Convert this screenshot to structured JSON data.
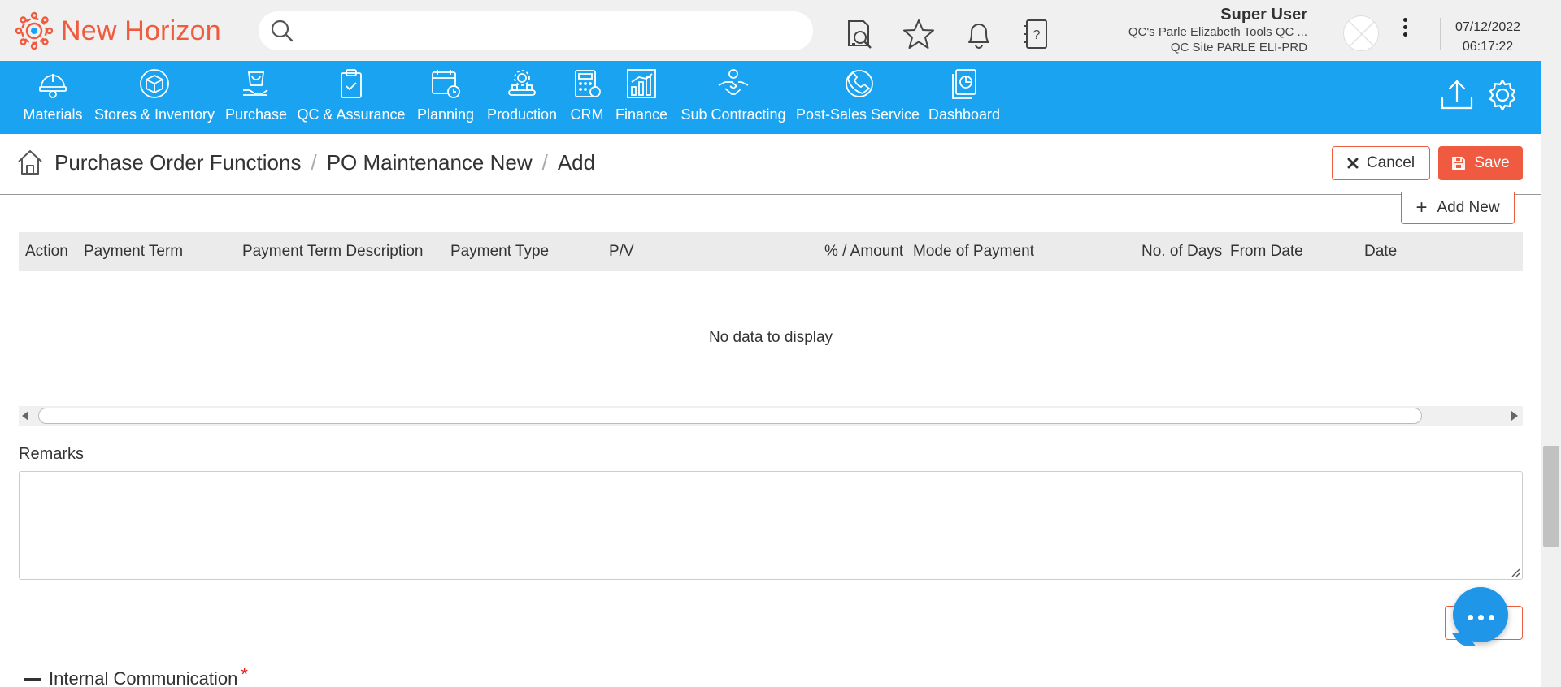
{
  "app": {
    "title": "New Horizon"
  },
  "search": {
    "placeholder": "",
    "value": ""
  },
  "user": {
    "name": "Super User",
    "company": "QC's Parle Elizabeth Tools QC ...",
    "site": "QC Site PARLE ELI-PRD"
  },
  "datetime": {
    "date": "07/12/2022",
    "time": "06:17:22"
  },
  "nav": {
    "items": [
      {
        "label": "Materials",
        "icon": "helmet-icon"
      },
      {
        "label": "Stores & Inventory",
        "icon": "box-icon"
      },
      {
        "label": "Purchase",
        "icon": "bag-icon"
      },
      {
        "label": "QC & Assurance",
        "icon": "clipboard-check-icon"
      },
      {
        "label": "Planning",
        "icon": "calendar-clock-icon"
      },
      {
        "label": "Production",
        "icon": "conveyor-gear-icon"
      },
      {
        "label": "CRM",
        "icon": "calculator-icon"
      },
      {
        "label": "Finance",
        "icon": "bar-chart-icon"
      },
      {
        "label": "Sub Contracting",
        "icon": "handshake-icon"
      },
      {
        "label": "Post-Sales Service",
        "icon": "headset-icon"
      },
      {
        "label": "Dashboard",
        "icon": "dashboard-icon"
      }
    ]
  },
  "breadcrumb": {
    "items": [
      "Purchase Order Functions",
      "PO Maintenance New",
      "Add"
    ],
    "separator": "/"
  },
  "actions": {
    "cancel_label": "Cancel",
    "save_label": "Save",
    "add_new_label": "Add New"
  },
  "payment_grid": {
    "columns": [
      "Action",
      "Payment Term",
      "Payment Term Description",
      "Payment Type",
      "P/V",
      "% / Amount",
      "Mode of Payment",
      "No. of Days",
      "From Date",
      "Date"
    ],
    "rows": [],
    "empty_text": "No data to display"
  },
  "remarks": {
    "label": "Remarks",
    "value": ""
  },
  "internal_communication": {
    "title": "Internal Communication",
    "required_mark": "*"
  },
  "colors": {
    "brand": "#ef5b3f",
    "nav_bg": "#1aa3f0",
    "save_bg": "#f05a40",
    "chat_fab": "#1f96e8"
  }
}
